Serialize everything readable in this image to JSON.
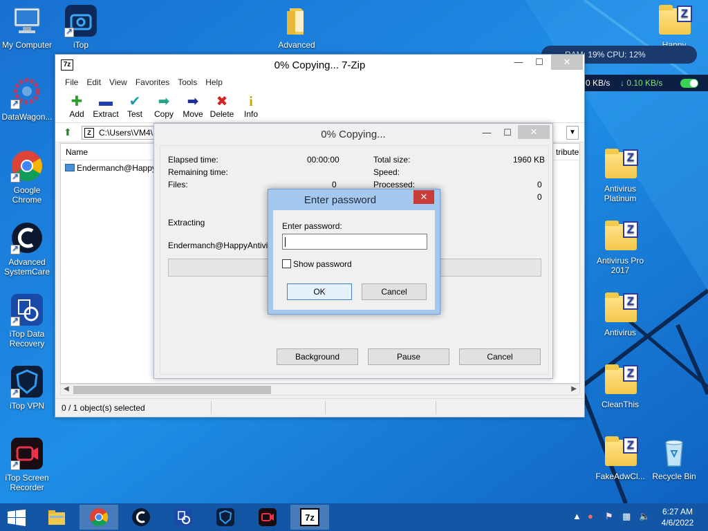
{
  "desktop": {
    "left_icons": [
      {
        "label": "My Computer"
      },
      {
        "label": "DataWagon..."
      },
      {
        "label": "Google Chrome"
      },
      {
        "label": "Advanced SystemCare"
      },
      {
        "label": "iTop Data Recovery"
      },
      {
        "label": "iTop VPN"
      },
      {
        "label": "iTop Screen Recorder"
      }
    ],
    "top_icons": [
      {
        "label": "iTop"
      },
      {
        "label": "Advanced"
      },
      {
        "label": "Happy Antivirus"
      }
    ],
    "right_icons": [
      {
        "label": "Antivirus Platinum"
      },
      {
        "label": "Antivirus Pro 2017"
      },
      {
        "label": "Antivirus"
      },
      {
        "label": "CleanThis"
      },
      {
        "label": "FakeAdwCl..."
      },
      {
        "label": "Recycle Bin"
      }
    ]
  },
  "net_widget": {
    "stats": "RAM: 19%  CPU: 12%",
    "up_speed": "0 KB/s",
    "down_speed": "↓ 0.10 KB/s"
  },
  "main_window": {
    "title": "0% Copying... 7-Zip",
    "app_icon": "7z",
    "menu": [
      "File",
      "Edit",
      "View",
      "Favorites",
      "Tools",
      "Help"
    ],
    "toolbar": [
      {
        "label": "Add",
        "icon": "plus-icon",
        "glyph": "✚",
        "color": "#2e9e2e"
      },
      {
        "label": "Extract",
        "icon": "minus-icon",
        "glyph": "▬",
        "color": "#1f3fae"
      },
      {
        "label": "Test",
        "icon": "check-icon",
        "glyph": "✔",
        "color": "#1a9bb0"
      },
      {
        "label": "Copy",
        "icon": "arrow-right-icon",
        "glyph": "➡",
        "color": "#2aa18a"
      },
      {
        "label": "Move",
        "icon": "arrow-right-icon",
        "glyph": "➡",
        "color": "#1a2f8f"
      },
      {
        "label": "Delete",
        "icon": "x-icon",
        "glyph": "✖",
        "color": "#d32222"
      },
      {
        "label": "Info",
        "icon": "info-icon",
        "glyph": "i",
        "color": "#c9a400"
      }
    ],
    "address": "C:\\Users\\VM4\\",
    "list_header_name": "Name",
    "list_header_attr": "tribute",
    "file_row": "Endermanch@Happy",
    "status": "0 / 1 object(s) selected"
  },
  "copy_dialog": {
    "title": "0% Copying...",
    "elapsed_label": "Elapsed time:",
    "elapsed_value": "00:00:00",
    "remaining_label": "Remaining time:",
    "files_label": "Files:",
    "files_value": "0",
    "total_size_label": "Total size:",
    "total_size_value": "1960 KB",
    "speed_label": "Speed:",
    "processed_label": "Processed:",
    "processed_value": "0",
    "extra_value": "0",
    "extracting_label": "Extracting",
    "file_path": "Endermanch@HappyAntivirus.",
    "buttons": {
      "background": "Background",
      "pause": "Pause",
      "cancel": "Cancel"
    }
  },
  "password_dialog": {
    "title": "Enter password",
    "prompt": "Enter password:",
    "value": "",
    "show_password": "Show password",
    "ok": "OK",
    "cancel": "Cancel"
  },
  "taskbar": {
    "time": "6:27 AM",
    "date": "4/6/2022"
  }
}
